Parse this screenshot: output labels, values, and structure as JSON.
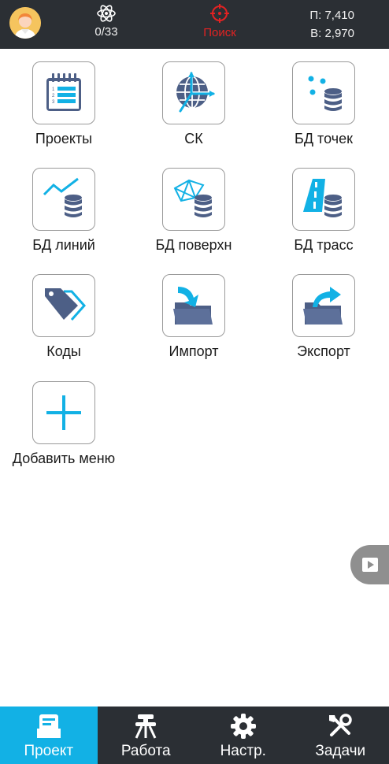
{
  "status_bar": {
    "satellites": "0/33",
    "search_label": "Поиск",
    "p_value": "П: 7,410",
    "v_value": "В: 2,970"
  },
  "menu": {
    "items": [
      {
        "label": "Проекты",
        "icon": "project-list-icon"
      },
      {
        "label": "СК",
        "icon": "coordinate-system-icon"
      },
      {
        "label": "БД точек",
        "icon": "points-database-icon"
      },
      {
        "label": "БД линий",
        "icon": "lines-database-icon"
      },
      {
        "label": "БД поверхн",
        "icon": "surface-database-icon"
      },
      {
        "label": "БД трасс",
        "icon": "road-database-icon"
      },
      {
        "label": "Коды",
        "icon": "codes-tag-icon"
      },
      {
        "label": "Импорт",
        "icon": "import-folder-icon"
      },
      {
        "label": "Экспорт",
        "icon": "export-folder-icon"
      },
      {
        "label": "Добавить меню",
        "icon": "add-icon"
      }
    ]
  },
  "bottom_nav": {
    "items": [
      {
        "label": "Проект",
        "icon": "tray-icon",
        "active": true
      },
      {
        "label": "Работа",
        "icon": "survey-instrument-icon",
        "active": false
      },
      {
        "label": "Настр.",
        "icon": "gear-icon",
        "active": false
      },
      {
        "label": "Задачи",
        "icon": "tools-icon",
        "active": false
      }
    ]
  },
  "colors": {
    "accent": "#12b1e5",
    "icon_dark": "#4d5f86",
    "topbar": "#2b2f34",
    "search_red": "#e32222"
  }
}
